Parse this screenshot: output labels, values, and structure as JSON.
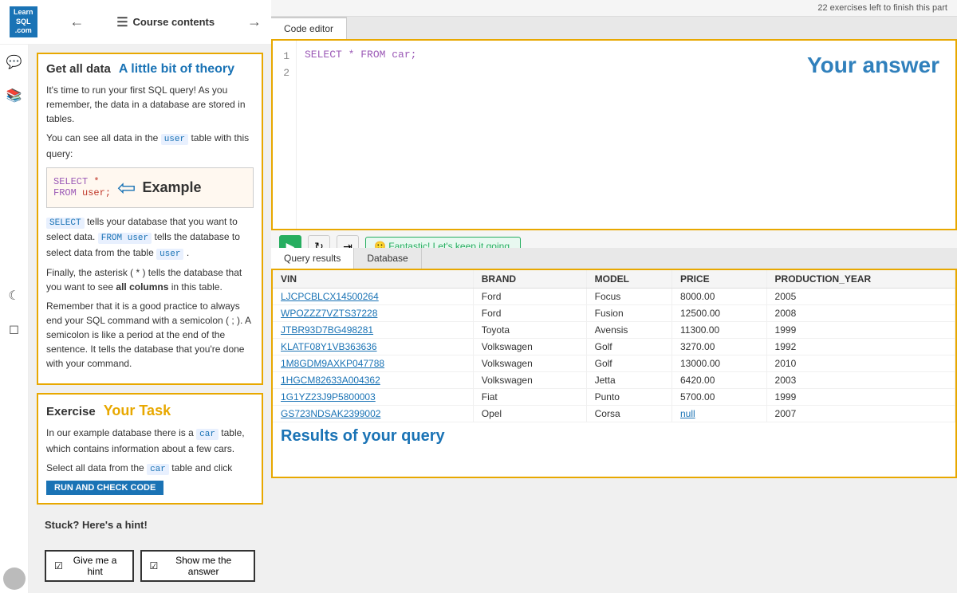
{
  "top_bar": {
    "logo_line1": "Learn",
    "logo_line2": "SQL",
    "logo_line3": ".com",
    "course_contents": "Course contents",
    "exercises_left": "22 exercises left to finish this part"
  },
  "theory": {
    "title": "Get all data",
    "subtitle": "A little bit of theory",
    "p1": "It's time to run your first SQL query! As you remember, the data in a database are stored in tables.",
    "p2_pre": "You can see all data in the",
    "p2_table": "user",
    "p2_post": "table with this query:",
    "example_code_line1": "SELECT *",
    "example_code_line2": "FROM user;",
    "example_label": "Example",
    "p3_pre": "SELECT",
    "p3_mid1": "tells your database that you want to select data.",
    "p3_code2": "FROM user",
    "p3_mid2": "tells the database to select data from the table",
    "p3_code3": "user",
    "p3_end": ".",
    "p4": "Finally, the asterisk ( * ) tells the database that you want to see all columns in this table.",
    "p5": "Remember that it is a good practice to always end your SQL command with a semicolon ( ; ). A semicolon is like a period at the end of the sentence. It tells the database that you're done with your command."
  },
  "exercise": {
    "title": "Exercise",
    "subtitle": "Your Task",
    "text1": "In our example database there is a",
    "code1": "car",
    "text2": "table, which contains information about a few cars.",
    "text3": "Select all data from the",
    "code2": "car",
    "text4": "table and click",
    "btn_label": "RUN AND CHECK CODE"
  },
  "hint": {
    "heading": "Stuck? Here's a hint!",
    "btn1": "Give me a hint",
    "btn2": "Show me the answer"
  },
  "editor": {
    "tab_label": "Code editor",
    "your_answer": "Your answer",
    "line1": "SELECT * FROM car;",
    "line_numbers": [
      "1",
      "2"
    ],
    "fantastic_msg": "🙂 Fantastic! Let's keep it going."
  },
  "results": {
    "tab1": "Query results",
    "tab2": "Database",
    "title": "Results of your query",
    "columns": [
      "VIN",
      "BRAND",
      "MODEL",
      "PRICE",
      "PRODUCTION_YEAR"
    ],
    "rows": [
      [
        "LJCPCBLCX14500264",
        "Ford",
        "Focus",
        "8000.00",
        "2005"
      ],
      [
        "WPOZZZ7VZTS37228",
        "Ford",
        "Fusion",
        "12500.00",
        "2008"
      ],
      [
        "JTBR93D7BG498281",
        "Toyota",
        "Avensis",
        "11300.00",
        "1999"
      ],
      [
        "KLATF08Y1VB363636",
        "Volkswagen",
        "Golf",
        "3270.00",
        "1992"
      ],
      [
        "1M8GDM9AXKP047788",
        "Volkswagen",
        "Golf",
        "13000.00",
        "2010"
      ],
      [
        "1HGCM82633A004362",
        "Volkswagen",
        "Jetta",
        "6420.00",
        "2003"
      ],
      [
        "1G1YZ23J9P5800003",
        "Fiat",
        "Punto",
        "5700.00",
        "1999"
      ],
      [
        "GS723NDSAK2399002",
        "Opel",
        "Corsa",
        "null",
        "2007"
      ]
    ]
  }
}
